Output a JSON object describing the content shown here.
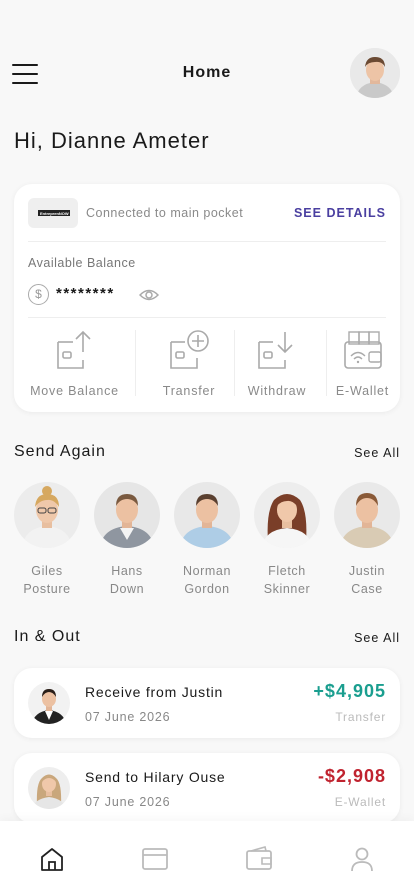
{
  "header": {
    "title": "Home"
  },
  "greeting": "Hi, Dianne Ameter",
  "balance_card": {
    "logo_text": "EntreprenNOW",
    "connected": "Connected to main pocket",
    "details": "SEE DETAILS",
    "available_label": "Available Balance",
    "currency_symbol": "$",
    "balance_masked": "********",
    "actions": [
      {
        "label": "Move Balance",
        "icon": "move-balance-icon"
      },
      {
        "label": "Transfer",
        "icon": "transfer-icon"
      },
      {
        "label": "Withdraw",
        "icon": "withdraw-icon"
      },
      {
        "label": "E-Wallet",
        "icon": "e-wallet-icon"
      }
    ]
  },
  "send_again": {
    "title": "Send Again",
    "see_all": "See All",
    "contacts": [
      {
        "first": "Giles",
        "last": "Posture"
      },
      {
        "first": "Hans",
        "last": "Down"
      },
      {
        "first": "Norman",
        "last": "Gordon"
      },
      {
        "first": "Fletch",
        "last": "Skinner"
      },
      {
        "first": "Justin",
        "last": "Case"
      }
    ]
  },
  "in_out": {
    "title": "In & Out",
    "see_all": "See All",
    "transactions": [
      {
        "title": "Receive from Justin",
        "date": "07 June 2026",
        "amount": "+$4,905",
        "type": "Transfer",
        "color": "#1a9e8f"
      },
      {
        "title": "Send to Hilary Ouse",
        "date": "07 June 2026",
        "amount": "-$2,908",
        "type": "E-Wallet",
        "color": "#c0232f"
      }
    ]
  },
  "nav": [
    {
      "icon": "home-icon",
      "active": true
    },
    {
      "icon": "card-icon",
      "active": false
    },
    {
      "icon": "wallet-icon",
      "active": false
    },
    {
      "icon": "profile-icon",
      "active": false
    }
  ]
}
